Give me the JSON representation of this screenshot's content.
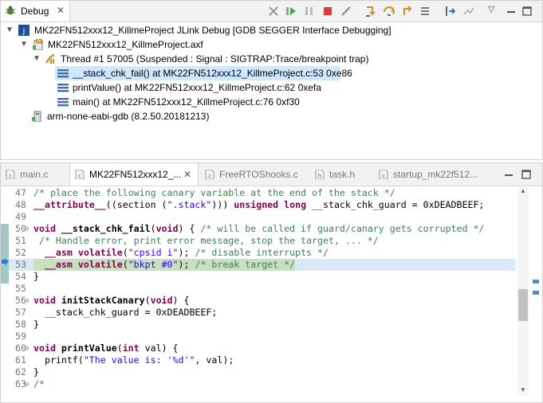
{
  "debug": {
    "tab_label": "Debug",
    "tree": [
      {
        "text": "MK22FN512xxx12_KillmeProject JLink Debug [GDB SEGGER Interface Debugging]",
        "icon": "jlink-launch-icon"
      },
      {
        "text": "MK22FN512xxx12_KillmeProject.axf",
        "icon": "process-icon"
      },
      {
        "text": "Thread #1 57005 (Suspended : Signal : SIGTRAP:Trace/breakpoint trap)",
        "icon": "thread-suspended-icon"
      },
      {
        "text": "__stack_chk_fail() at MK22FN512xxx12_KillmeProject.c:53 0xe86",
        "icon": "stack-frame-icon"
      },
      {
        "text": "printValue() at MK22FN512xxx12_KillmeProject.c:62 0xefa",
        "icon": "stack-frame-icon"
      },
      {
        "text": "main() at MK22FN512xxx12_KillmeProject.c:76 0xf30",
        "icon": "stack-frame-icon"
      },
      {
        "text": "arm-none-eabi-gdb (8.2.50.20181213)",
        "icon": "gdb-process-icon"
      }
    ]
  },
  "editor": {
    "tabs": [
      {
        "label": "main.c",
        "icon": "c-file-icon"
      },
      {
        "label": "MK22FN512xxx12_...",
        "icon": "c-file-icon"
      },
      {
        "label": "FreeRTOShooks.c",
        "icon": "c-file-icon"
      },
      {
        "label": "task.h",
        "icon": "h-file-icon"
      },
      {
        "label": "startup_mk22f512...",
        "icon": "c-file-icon"
      }
    ],
    "lines": [
      {
        "n": "47",
        "code": "/* place the following canary variable at the end of the stack */"
      },
      {
        "n": "48",
        "code": "__attribute__((section (\".stack\"))) unsigned long __stack_chk_guard = 0xDEADBEEF;"
      },
      {
        "n": "49",
        "code": ""
      },
      {
        "n": "50",
        "code": "void __stack_chk_fail(void) { /* will be called if guard/canary gets corrupted */"
      },
      {
        "n": "51",
        "code": " /* Handle error, print error message, stop the target, ... */"
      },
      {
        "n": "52",
        "code": "  __asm volatile(\"cpsid i\"); /* disable interrupts */"
      },
      {
        "n": "53",
        "code": "  __asm volatile(\"bkpt #0\"); /* break target */"
      },
      {
        "n": "54",
        "code": "}"
      },
      {
        "n": "55",
        "code": ""
      },
      {
        "n": "56",
        "code": "void initStackCanary(void) {"
      },
      {
        "n": "57",
        "code": "  __stack_chk_guard = 0xDEADBEEF;"
      },
      {
        "n": "58",
        "code": "}"
      },
      {
        "n": "59",
        "code": ""
      },
      {
        "n": "60",
        "code": "void printValue(int val) {"
      },
      {
        "n": "61",
        "code": "  printf(\"The value is: '%d'\", val);"
      },
      {
        "n": "62",
        "code": "}"
      },
      {
        "n": "63",
        "code": "/*"
      }
    ]
  }
}
